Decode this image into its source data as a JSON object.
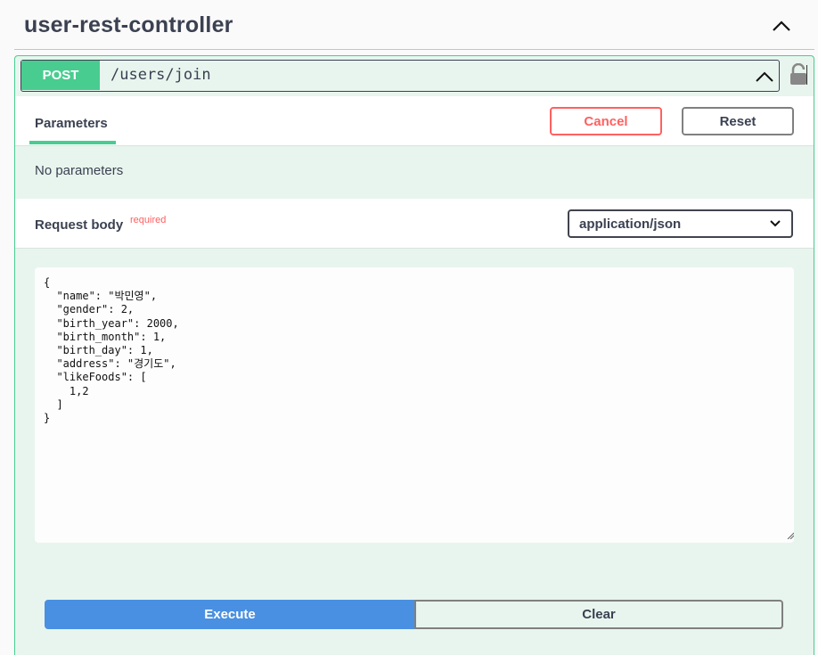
{
  "tag": {
    "title": "user-rest-controller"
  },
  "operation": {
    "method": "POST",
    "path": "/users/join"
  },
  "parameters": {
    "tab_label": "Parameters",
    "cancel_label": "Cancel",
    "reset_label": "Reset",
    "empty_text": "No parameters"
  },
  "request_body": {
    "label": "Request body",
    "required_label": "required",
    "content_type": "application/json",
    "value": "{\n  \"name\": \"박민영\",\n  \"gender\": 2,\n  \"birth_year\": 2000,\n  \"birth_month\": 1,\n  \"birth_day\": 1,\n  \"address\": \"경기도\",\n  \"likeFoods\": [\n    1,2\n  ]\n}"
  },
  "actions": {
    "execute_label": "Execute",
    "clear_label": "Clear"
  },
  "colors": {
    "post_green": "#49cc90",
    "cancel_red": "#ff6060",
    "execute_blue": "#4990e2"
  },
  "icons": {
    "tag_toggle": "chevron-up-icon",
    "summary_toggle": "chevron-up-icon",
    "auth": "lock-icon",
    "select": "chevron-down-icon"
  }
}
